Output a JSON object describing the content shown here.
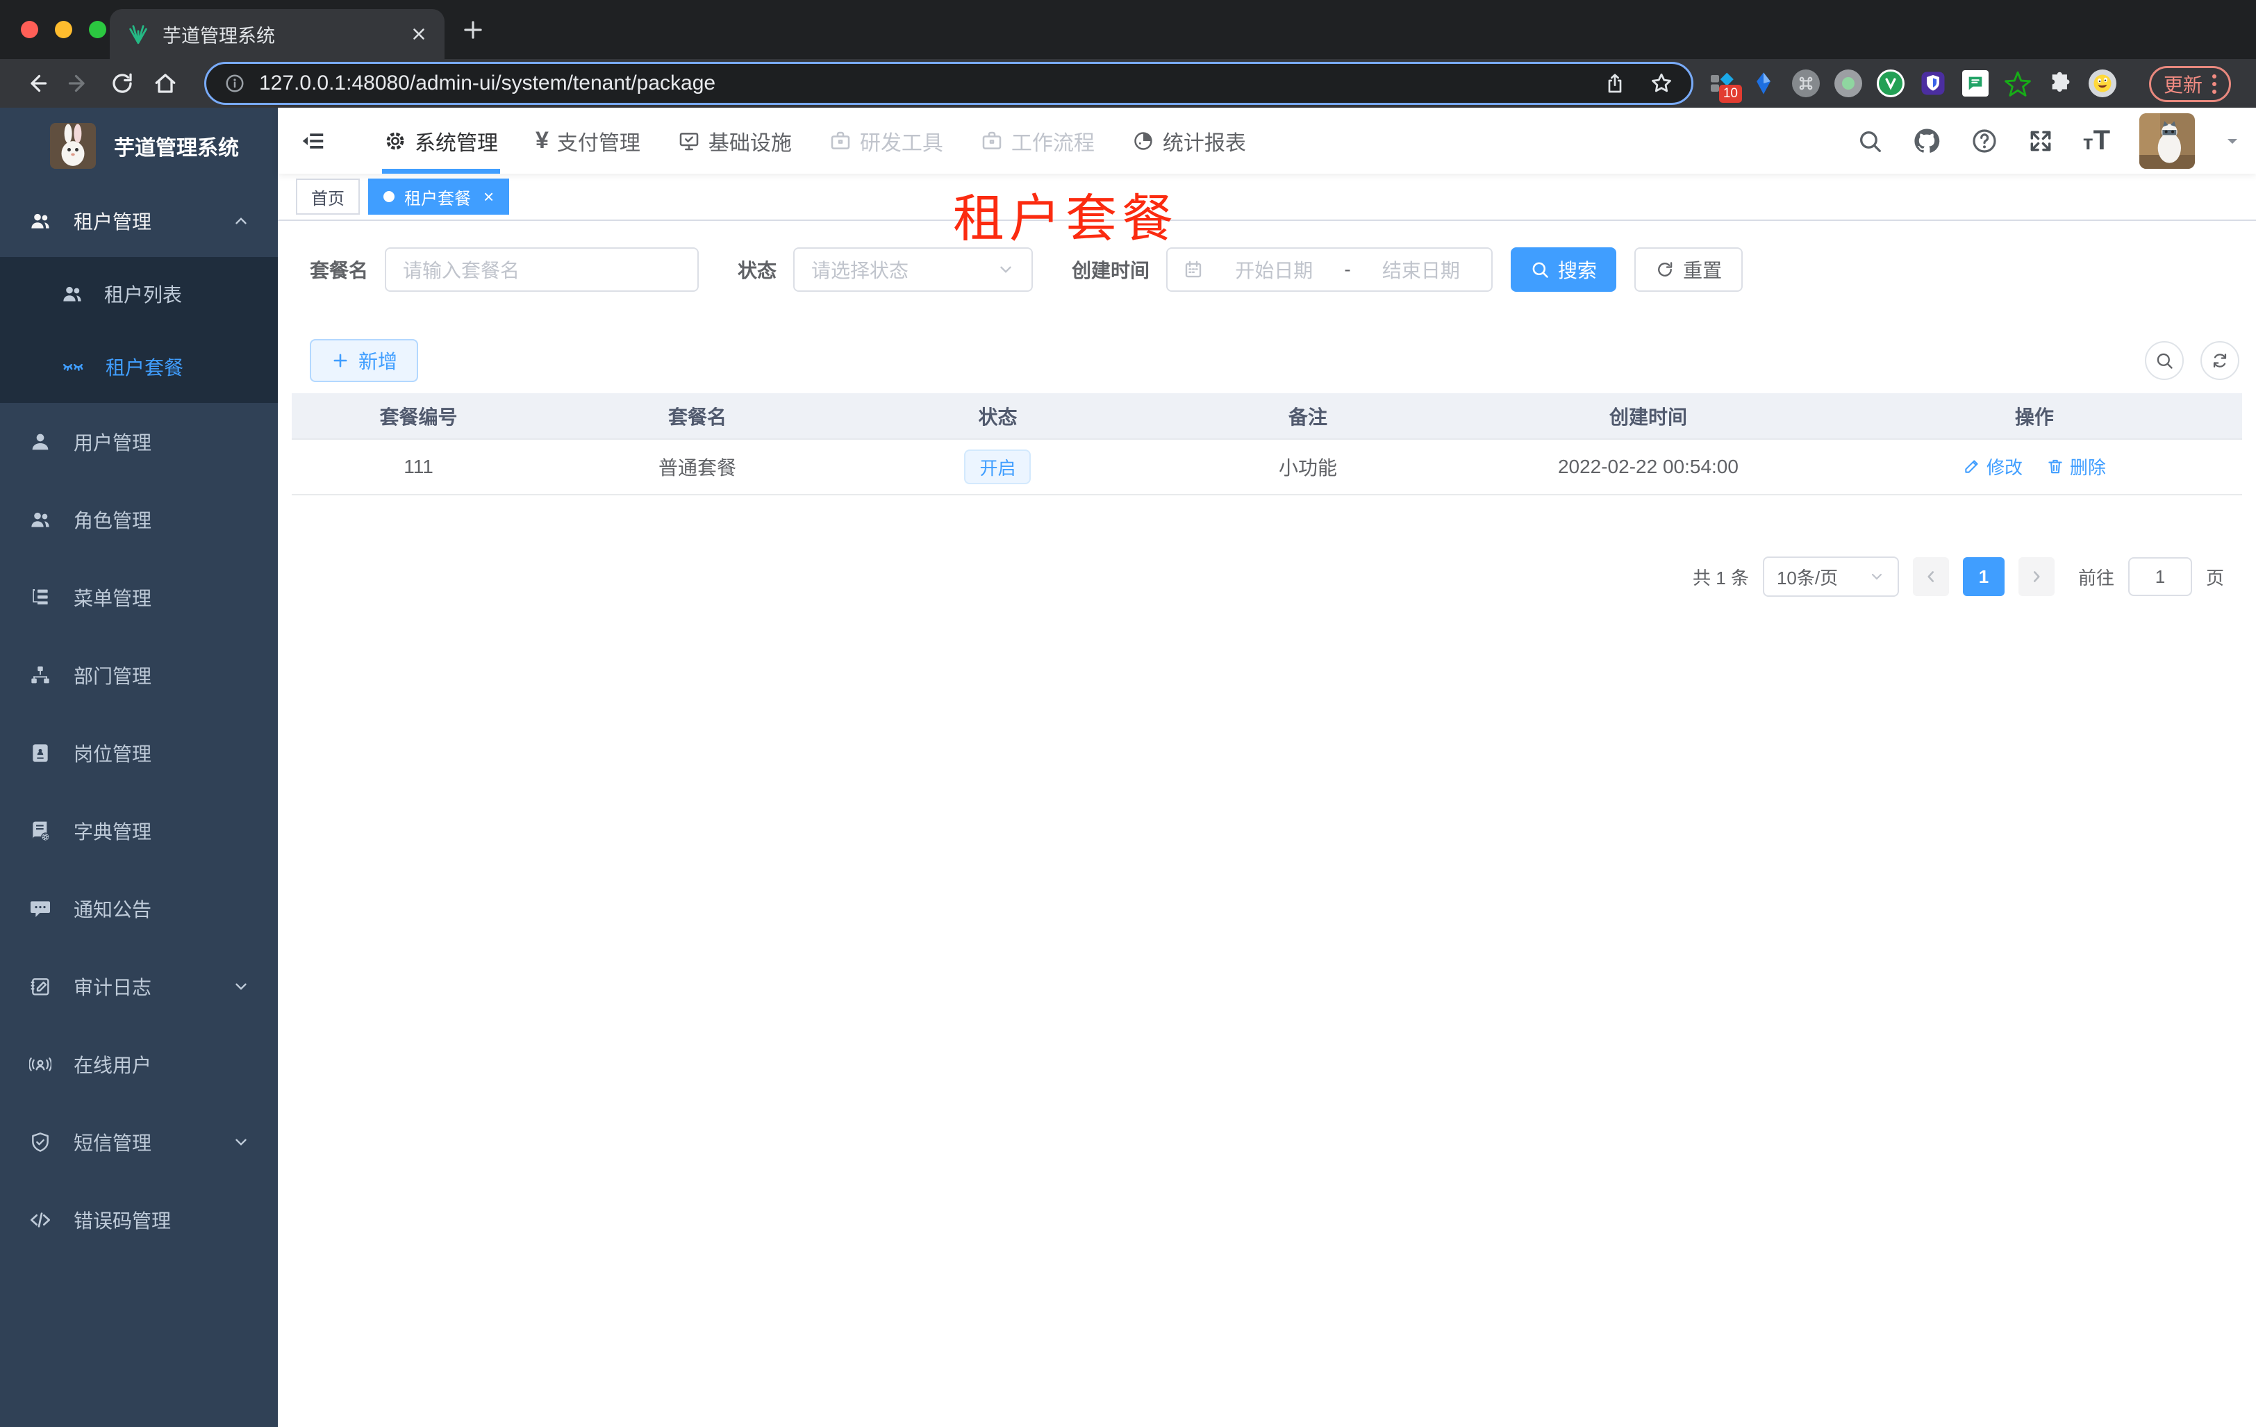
{
  "browser": {
    "tab_title": "芋道管理系统",
    "url": "127.0.0.1:48080/admin-ui/system/tenant/package",
    "extension_badge": "10",
    "update_label": "更新"
  },
  "annotation": {
    "title": "租户套餐",
    "color": "#fb2b10"
  },
  "sidebar": {
    "app_title": "芋道管理系统",
    "menu": [
      {
        "label": "租户管理",
        "icon": "user-group-icon",
        "state": "open"
      },
      {
        "label": "租户列表",
        "icon": "tenant-list-icon",
        "state": "normal"
      },
      {
        "label": "租户套餐",
        "icon": "tenant-package-icon",
        "state": "active"
      },
      {
        "label": "用户管理",
        "icon": "user-icon"
      },
      {
        "label": "角色管理",
        "icon": "role-icon"
      },
      {
        "label": "菜单管理",
        "icon": "menu-tree-icon"
      },
      {
        "label": "部门管理",
        "icon": "org-chart-icon"
      },
      {
        "label": "岗位管理",
        "icon": "post-badge-icon"
      },
      {
        "label": "字典管理",
        "icon": "dictionary-icon"
      },
      {
        "label": "通知公告",
        "icon": "notice-icon"
      },
      {
        "label": "审计日志",
        "icon": "audit-log-icon",
        "caret": "down"
      },
      {
        "label": "在线用户",
        "icon": "online-user-icon"
      },
      {
        "label": "短信管理",
        "icon": "sms-shield-icon",
        "caret": "down"
      },
      {
        "label": "错误码管理",
        "icon": "error-code-icon"
      }
    ]
  },
  "header": {
    "nav": [
      {
        "label": "系统管理",
        "icon": "gear-icon",
        "state": "active"
      },
      {
        "label": "支付管理",
        "icon": "yen-icon",
        "state": "normal"
      },
      {
        "label": "基础设施",
        "icon": "monitor-icon",
        "state": "normal"
      },
      {
        "label": "研发工具",
        "icon": "briefcase-icon",
        "state": "disabled"
      },
      {
        "label": "工作流程",
        "icon": "briefcase-icon",
        "state": "disabled"
      },
      {
        "label": "统计报表",
        "icon": "pie-report-icon",
        "state": "normal"
      }
    ]
  },
  "tags": {
    "home": "首页",
    "active": "租户套餐"
  },
  "filters": {
    "name_label": "套餐名",
    "name_placeholder": "请输入套餐名",
    "status_label": "状态",
    "status_placeholder": "请选择状态",
    "date_label": "创建时间",
    "date_start_placeholder": "开始日期",
    "date_separator": "-",
    "date_end_placeholder": "结束日期",
    "search_label": "搜索",
    "reset_label": "重置"
  },
  "toolbar": {
    "add_label": "新增"
  },
  "table": {
    "columns": [
      "套餐编号",
      "套餐名",
      "状态",
      "备注",
      "创建时间",
      "操作"
    ],
    "rows": [
      {
        "id": "111",
        "name": "普通套餐",
        "status": "开启",
        "remark": "小功能",
        "created_at": "2022-02-22 00:54:00",
        "edit_label": "修改",
        "delete_label": "删除"
      }
    ]
  },
  "pagination": {
    "total_label": "共 1 条",
    "page_size": "10条/页",
    "current_page": "1",
    "goto_label": "前往",
    "goto_value": "1",
    "page_unit": "页"
  },
  "colors": {
    "accent": "#409eff",
    "sidebar_bg": "#304156",
    "submenu_bg": "#1f2d3d",
    "annotation_red": "#fb2b10"
  }
}
